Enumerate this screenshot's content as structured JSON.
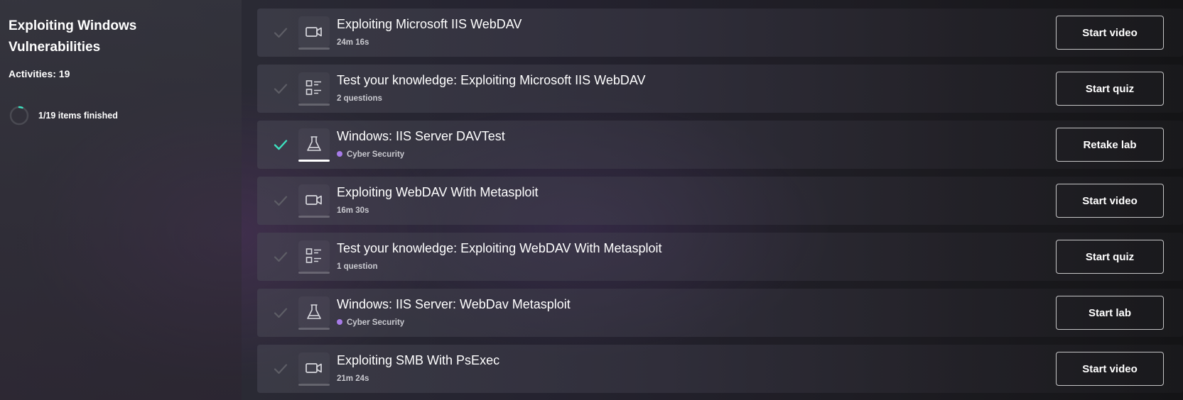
{
  "sidebar": {
    "title": "Exploiting Windows Vulnerabilities",
    "activities": "Activities: 19",
    "progress": {
      "text": "1/19 items finished",
      "completed": 1,
      "total": 19
    }
  },
  "colors": {
    "check_done": "#3de2c0",
    "tag_dot": "#a77be8"
  },
  "items": [
    {
      "title": "Exploiting Microsoft IIS WebDAV",
      "meta": "24m 16s",
      "type_icon": "video-camera-icon",
      "button": "Start video",
      "done": false
    },
    {
      "title": "Test your knowledge: Exploiting Microsoft IIS WebDAV",
      "meta": "2 questions",
      "type_icon": "quiz-list-icon",
      "button": "Start quiz",
      "done": false
    },
    {
      "title": "Windows: IIS Server DAVTest",
      "meta": "Cyber Security",
      "type_icon": "lab-flask-icon",
      "button": "Retake lab",
      "done": true
    },
    {
      "title": "Exploiting WebDAV With Metasploit",
      "meta": "16m 30s",
      "type_icon": "video-camera-icon",
      "button": "Start video",
      "done": false
    },
    {
      "title": "Test your knowledge: Exploiting WebDAV With Metasploit",
      "meta": "1 question",
      "type_icon": "quiz-list-icon",
      "button": "Start quiz",
      "done": false
    },
    {
      "title": "Windows: IIS Server: WebDav Metasploit",
      "meta": "Cyber Security",
      "type_icon": "lab-flask-icon",
      "button": "Start lab",
      "done": false
    },
    {
      "title": "Exploiting SMB With PsExec",
      "meta": "21m 24s",
      "type_icon": "video-camera-icon",
      "button": "Start video",
      "done": false
    }
  ]
}
